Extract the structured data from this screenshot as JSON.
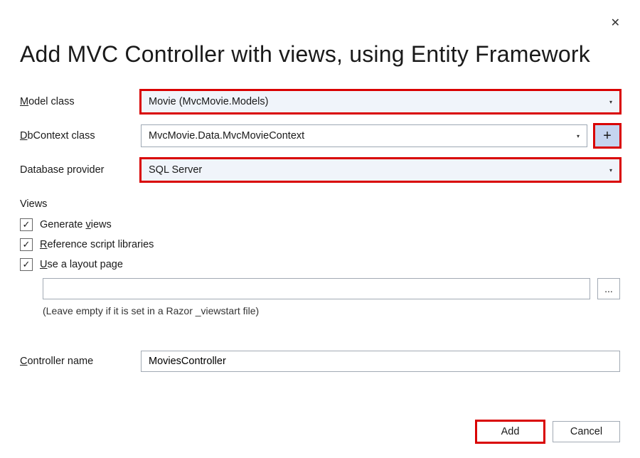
{
  "dialog": {
    "title": "Add MVC Controller with views, using Entity Framework",
    "close_glyph": "✕"
  },
  "labels": {
    "model_class": "Model class",
    "dbcontext_class": "DbContext class",
    "database_provider": "Database provider",
    "views_heading": "Views",
    "controller_name_prefix": "C",
    "controller_name_rest": "ontroller name"
  },
  "fields": {
    "model_class": "Movie (MvcMovie.Models)",
    "dbcontext_class": "MvcMovie.Data.MvcMovieContext",
    "database_provider": "SQL Server",
    "layout_page": "",
    "controller_name": "MoviesController"
  },
  "checkboxes": {
    "generate_views_prefix": "Generate ",
    "generate_views_u": "v",
    "generate_views_rest": "iews",
    "reference_u": "R",
    "reference_rest": "eference script libraries",
    "layout_u": "U",
    "layout_rest": "se a layout page",
    "checkmark": "✓"
  },
  "hint": "(Leave empty if it is set in a Razor _viewstart file)",
  "buttons": {
    "plus": "+",
    "browse": "...",
    "add": "Add",
    "cancel": "Cancel"
  },
  "caret": "▾"
}
